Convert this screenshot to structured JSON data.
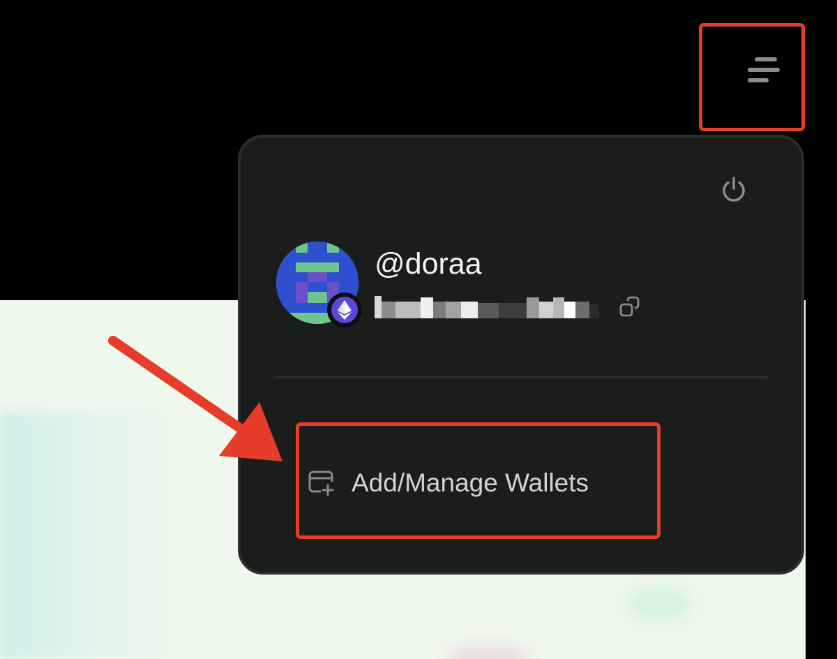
{
  "header": {
    "menu_icon": "hamburger-menu-icon"
  },
  "account_menu": {
    "power_icon": "power-icon",
    "avatar_icon": "pixel-avatar",
    "chain_icon": "ethereum-icon",
    "username": "@doraa",
    "address": "",
    "copy_icon": "copy-icon",
    "items": [
      {
        "label": "Add/Manage Wallets",
        "icon": "wallet-add-icon"
      }
    ]
  },
  "annotations": {
    "highlight_color": "#e53d2a",
    "arrow_color": "#e53d2a"
  },
  "colors": {
    "panel_background": "#1b1c1c",
    "header_background": "#000000",
    "page_background": "#eef8ec",
    "chain_badge": "#5a48d8"
  }
}
